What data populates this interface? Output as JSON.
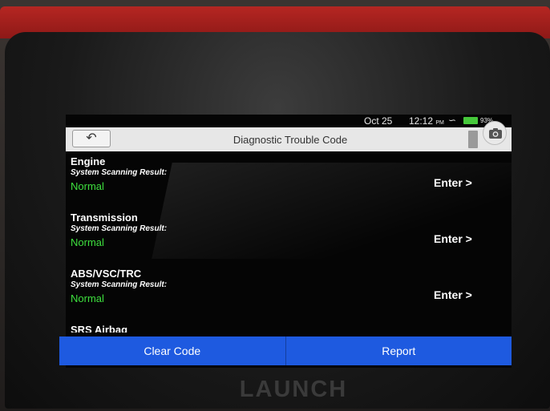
{
  "status_bar": {
    "date": "Oct 25",
    "time": "12:12",
    "ampm": "PM",
    "battery": "93%",
    "wifi_icon": "wifi-icon",
    "battery_color": "#46c83b"
  },
  "header": {
    "title": "Diagnostic Trouble Code",
    "back_icon": "back-arrow-icon",
    "camera_icon": "camera-icon"
  },
  "systems": [
    {
      "name": "Engine",
      "result_label": "System Scanning Result:",
      "status": "Normal",
      "action": "Enter >"
    },
    {
      "name": "Transmission",
      "result_label": "System Scanning Result:",
      "status": "Normal",
      "action": "Enter >"
    },
    {
      "name": "ABS/VSC/TRC",
      "result_label": "System Scanning Result:",
      "status": "Normal",
      "action": "Enter >"
    },
    {
      "name": "SRS Airbag"
    }
  ],
  "footer": {
    "clear_code": "Clear Code",
    "report": "Report",
    "accent": "#1e5ae0"
  },
  "device": {
    "brand": "LAUNCH"
  },
  "colors": {
    "status_normal": "#3ee03e",
    "frame_red": "#b52622"
  }
}
